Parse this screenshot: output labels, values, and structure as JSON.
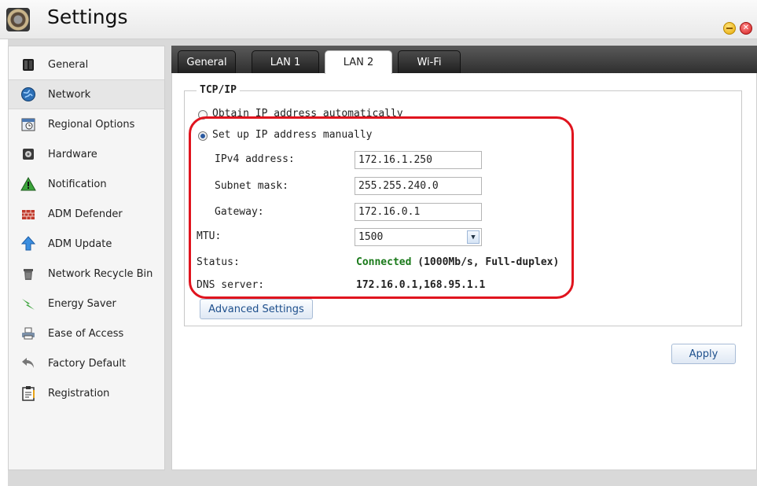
{
  "window": {
    "title": "Settings"
  },
  "sidebar": {
    "items": [
      {
        "label": "General",
        "icon": "server-icon"
      },
      {
        "label": "Network",
        "icon": "globe-icon",
        "active": true
      },
      {
        "label": "Regional Options",
        "icon": "calendar-clock-icon"
      },
      {
        "label": "Hardware",
        "icon": "hardware-icon"
      },
      {
        "label": "Notification",
        "icon": "warning-icon"
      },
      {
        "label": "ADM Defender",
        "icon": "firewall-icon"
      },
      {
        "label": "ADM Update",
        "icon": "update-arrow-icon"
      },
      {
        "label": "Network Recycle Bin",
        "icon": "recycle-bin-icon"
      },
      {
        "label": "Energy Saver",
        "icon": "energy-icon"
      },
      {
        "label": "Ease of Access",
        "icon": "printer-icon"
      },
      {
        "label": "Factory Default",
        "icon": "undo-arrow-icon"
      },
      {
        "label": "Registration",
        "icon": "clipboard-icon"
      }
    ]
  },
  "tabs": [
    {
      "label": "General"
    },
    {
      "label": "LAN 1"
    },
    {
      "label": "LAN 2",
      "active": true
    },
    {
      "label": "Wi-Fi"
    }
  ],
  "tcpip": {
    "legend": "TCP/IP",
    "auto_label": "Obtain IP address automatically",
    "manual_label": "Set up IP address manually",
    "mode": "manual",
    "ipv4_label": "IPv4 address:",
    "ipv4_value": "172.16.1.250",
    "subnet_label": "Subnet mask:",
    "subnet_value": "255.255.240.0",
    "gateway_label": "Gateway:",
    "gateway_value": "172.16.0.1",
    "mtu_label": "MTU:",
    "mtu_value": "1500",
    "status_label": "Status:",
    "status_value": "Connected",
    "status_detail": "(1000Mb/s, Full-duplex)",
    "dns_label": "DNS server:",
    "dns_value": "172.16.0.1,168.95.1.1"
  },
  "buttons": {
    "advanced": "Advanced Settings",
    "apply": "Apply"
  },
  "colors": {
    "highlight": "#e0141e",
    "status_connected": "#1a7a1a",
    "button_text": "#1d4f8c"
  }
}
